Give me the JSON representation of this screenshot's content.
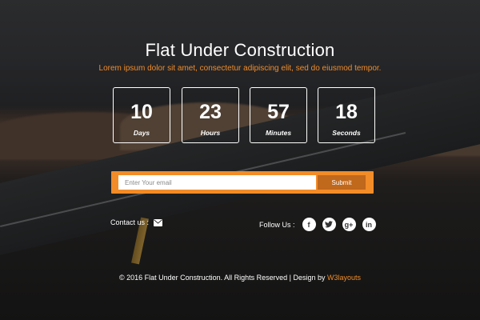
{
  "page": {
    "title": "Flat Under Construction",
    "subtitle": "Lorem ipsum dolor sit amet, consectetur adipiscing elit, sed do eiusmod tempor."
  },
  "countdown": [
    {
      "value": "10",
      "label": "Days"
    },
    {
      "value": "23",
      "label": "Hours"
    },
    {
      "value": "57",
      "label": "Minutes"
    },
    {
      "value": "18",
      "label": "Seconds"
    }
  ],
  "subscribe": {
    "placeholder": "Enter Your email",
    "value": "",
    "button_label": "Submit"
  },
  "contact": {
    "label": "Contact us :",
    "icon": "envelope-icon"
  },
  "social": {
    "label": "Follow Us :",
    "items": [
      {
        "name": "facebook",
        "glyph": "f"
      },
      {
        "name": "twitter",
        "glyph": "t"
      },
      {
        "name": "google-plus",
        "glyph": "g+"
      },
      {
        "name": "linkedin",
        "glyph": "in"
      }
    ]
  },
  "footer": {
    "text": "© 2016 Flat Under Construction. All Rights Reserved | Design by ",
    "brand": "W3layouts"
  },
  "colors": {
    "accent": "#f28c28",
    "submit": "#c0681c",
    "text": "#ffffff"
  }
}
